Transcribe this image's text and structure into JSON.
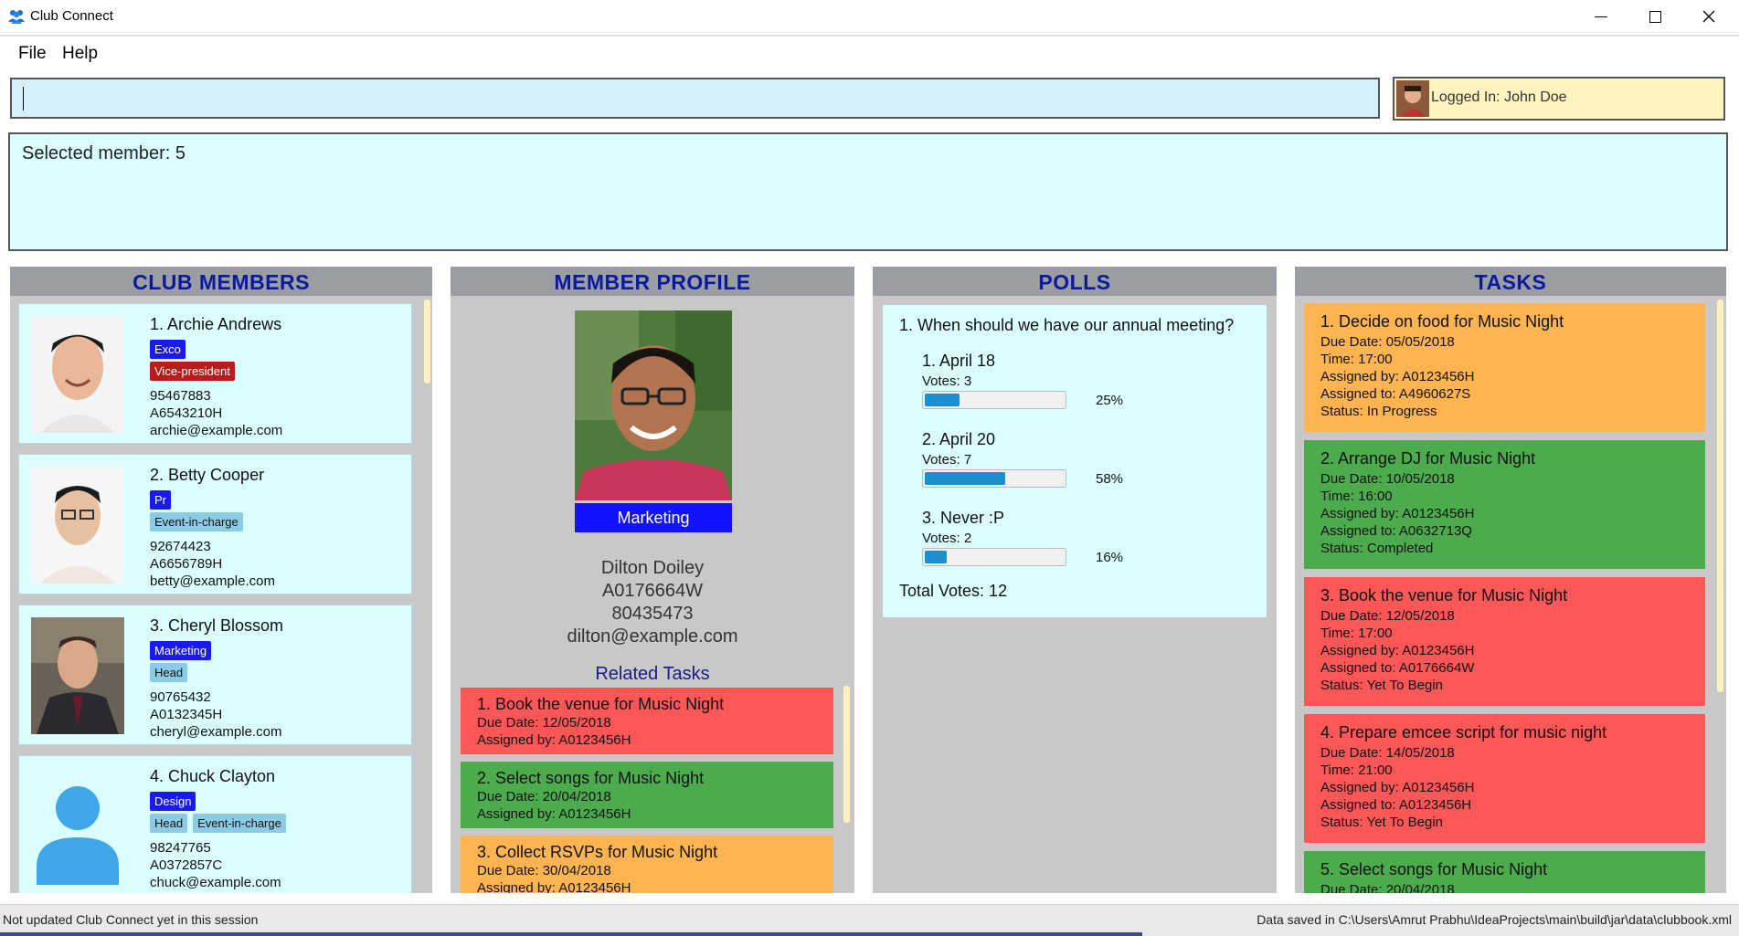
{
  "window": {
    "title": "Club Connect"
  },
  "menu": {
    "file": "File",
    "help": "Help"
  },
  "command": {
    "value": ""
  },
  "login": {
    "text": "Logged In: John Doe"
  },
  "result": {
    "text": "Selected member: 5"
  },
  "panels": {
    "members": "CLUB MEMBERS",
    "profile": "MEMBER PROFILE",
    "polls": "POLLS",
    "tasks": "TASKS"
  },
  "members": [
    {
      "name": "1.  Archie Andrews",
      "tags1": [
        "Exco"
      ],
      "tags2": [
        "Vice-president"
      ],
      "phone": "95467883",
      "matric": "A6543210H",
      "email": "archie@example.com"
    },
    {
      "name": "2.  Betty Cooper",
      "tags1": [
        "Pr"
      ],
      "tags2": [
        "Event-in-charge"
      ],
      "phone": "92674423",
      "matric": "A6656789H",
      "email": "betty@example.com"
    },
    {
      "name": "3.  Cheryl Blossom",
      "tags1": [
        "Marketing"
      ],
      "tags2": [
        "Head"
      ],
      "phone": "90765432",
      "matric": "A0132345H",
      "email": "cheryl@example.com"
    },
    {
      "name": "4.  Chuck Clayton",
      "tags1": [
        "Design"
      ],
      "tags2": [
        "Head",
        "Event-in-charge"
      ],
      "phone": "98247765",
      "matric": "A0372857C",
      "email": "chuck@example.com"
    }
  ],
  "profile": {
    "group": "Marketing",
    "name": "Dilton Doiley",
    "matric": "A0176664W",
    "phone": "80435473",
    "email": "dilton@example.com",
    "related_title": "Related Tasks",
    "tasks": [
      {
        "title": "1.  Book the venue for Music Night",
        "due": "Due Date: 12/05/2018",
        "by": "Assigned by: A0123456H",
        "color": "#fd5757"
      },
      {
        "title": "2.  Select songs for Music Night",
        "due": "Due Date: 20/04/2018",
        "by": "Assigned by: A0123456H",
        "color": "#4cab4c"
      },
      {
        "title": "3.  Collect RSVPs for Music Night",
        "due": "Due Date: 30/04/2018",
        "by": "Assigned by: A0123456H",
        "color": "#fdb451"
      }
    ]
  },
  "poll": {
    "question": "1.  When should we have our annual meeting?",
    "options": [
      {
        "label": "1.  April 18",
        "votes": "Votes: 3",
        "percent_text": "25%",
        "percent": 25
      },
      {
        "label": "2.  April 20",
        "votes": "Votes: 7",
        "percent_text": "58%",
        "percent": 58
      },
      {
        "label": "3.  Never :P",
        "votes": "Votes: 2",
        "percent_text": "16%",
        "percent": 16
      }
    ],
    "total": "Total Votes: 12"
  },
  "tasks": [
    {
      "title": "1. Decide on food for Music Night",
      "due": "Due Date: 05/05/2018",
      "time": "Time: 17:00",
      "by": "Assigned by: A0123456H",
      "to": "Assigned to: A4960627S",
      "status": "Status: In Progress",
      "color": "#fdb451"
    },
    {
      "title": "2. Arrange DJ for Music Night",
      "due": "Due Date: 10/05/2018",
      "time": "Time: 16:00",
      "by": "Assigned by: A0123456H",
      "to": "Assigned to: A0632713Q",
      "status": "Status: Completed",
      "color": "#4cab4c"
    },
    {
      "title": "3. Book the venue for Music Night",
      "due": "Due Date: 12/05/2018",
      "time": "Time: 17:00",
      "by": "Assigned by: A0123456H",
      "to": "Assigned to: A0176664W",
      "status": "Status: Yet To Begin",
      "color": "#fd5757"
    },
    {
      "title": "4. Prepare emcee script for music night",
      "due": "Due Date: 14/05/2018",
      "time": "Time: 21:00",
      "by": "Assigned by: A0123456H",
      "to": "Assigned to: A0123456H",
      "status": "Status: Yet To Begin",
      "color": "#fd5757"
    },
    {
      "title": "5. Select songs for Music Night",
      "due": "Due Date: 20/04/2018",
      "time": "",
      "by": "",
      "to": "",
      "status": "",
      "color": "#4cab4c"
    }
  ],
  "status": {
    "left": "Not updated Club Connect yet in this session",
    "right": "Data saved in C:\\Users\\Amrut Prabhu\\IdeaProjects\\main\\build\\jar\\data\\clubbook.xml"
  }
}
